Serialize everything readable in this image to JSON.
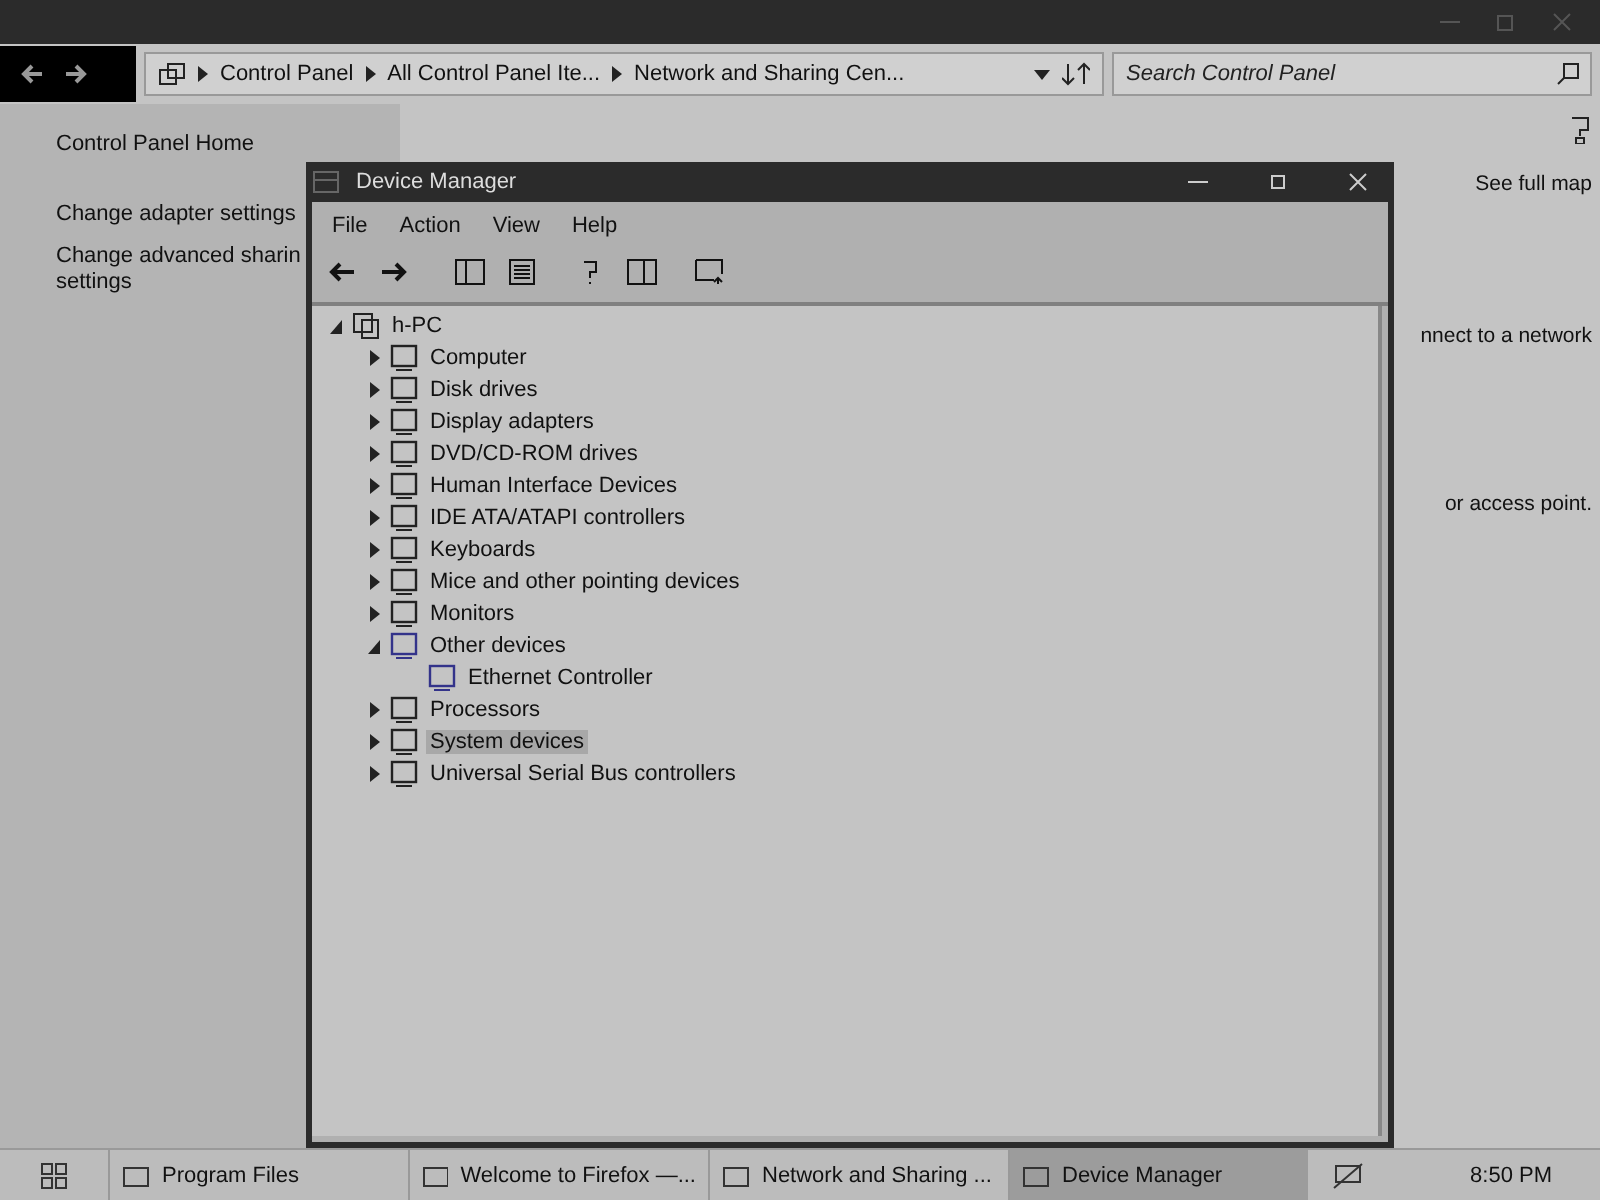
{
  "explorer": {
    "crumbs": [
      "Control Panel",
      "All Control Panel Ite...",
      "Network and Sharing Cen..."
    ],
    "search": {
      "placeholder": "Search Control Panel"
    },
    "sidebar": [
      {
        "lines": [
          "Control Panel Home"
        ]
      },
      {
        "lines": [
          "Change adapter settings"
        ]
      },
      {
        "lines": [
          "Change advanced sharin",
          "settings"
        ]
      }
    ],
    "content": [
      "See full map",
      "nnect to a network",
      "or access point."
    ]
  },
  "device_manager": {
    "title": "Device Manager",
    "menu": [
      "File",
      "Action",
      "View",
      "Help"
    ],
    "tree": {
      "label": "h-PC",
      "expanded": true,
      "children": [
        {
          "label": "Computer",
          "expanded": false,
          "selected": false
        },
        {
          "label": "Disk drives",
          "expanded": false,
          "selected": false
        },
        {
          "label": "Display adapters",
          "expanded": false,
          "selected": false
        },
        {
          "label": "DVD/CD-ROM drives",
          "expanded": false,
          "selected": false
        },
        {
          "label": "Human Interface Devices",
          "expanded": false,
          "selected": false
        },
        {
          "label": "IDE ATA/ATAPI controllers",
          "expanded": false,
          "selected": false
        },
        {
          "label": "Keyboards",
          "expanded": false,
          "selected": false
        },
        {
          "label": "Mice and other pointing devices",
          "expanded": false,
          "selected": false
        },
        {
          "label": "Monitors",
          "expanded": false,
          "selected": false
        },
        {
          "label": "Other devices",
          "expanded": true,
          "selected": false,
          "children": [
            {
              "label": "Ethernet Controller",
              "selected": false
            }
          ]
        },
        {
          "label": "Processors",
          "expanded": false,
          "selected": false
        },
        {
          "label": "System devices",
          "expanded": false,
          "selected": true
        },
        {
          "label": "Universal Serial Bus controllers",
          "expanded": false,
          "selected": false
        }
      ]
    }
  },
  "taskbar": {
    "items": [
      {
        "label": "Program Files",
        "selected": false
      },
      {
        "label": "Welcome to Firefox —...",
        "selected": false
      },
      {
        "label": "Network and Sharing ...",
        "selected": false
      },
      {
        "label": "Device Manager",
        "selected": true
      }
    ],
    "clock": "8:50 PM"
  }
}
